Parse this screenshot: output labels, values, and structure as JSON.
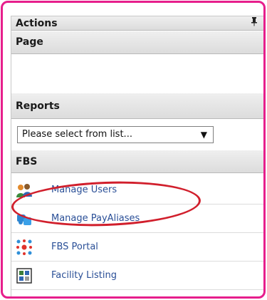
{
  "panel": {
    "actions_title": "Actions",
    "pin_glyph": "ᵖ",
    "page_title": "Page",
    "reports_title": "Reports",
    "select_value": "Please select from list...",
    "fbs_title": "FBS"
  },
  "menu": [
    {
      "label": "Manage Users",
      "icon": "users-icon"
    },
    {
      "label": "Manage PayAliases",
      "icon": "puzzle-icon"
    },
    {
      "label": "FBS Portal",
      "icon": "portal-icon"
    },
    {
      "label": "Facility Listing",
      "icon": "listing-icon"
    }
  ],
  "colors": {
    "frame": "#e61e8c",
    "link": "#2a4f97",
    "highlight_circle": "#d11f2c"
  }
}
